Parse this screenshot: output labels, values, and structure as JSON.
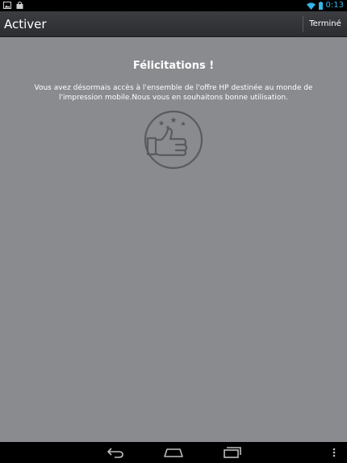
{
  "status_bar": {
    "time": "0:13",
    "icons": [
      "image-notification-icon",
      "store-notification-icon",
      "wifi-icon",
      "battery-icon"
    ],
    "accent_color": "#33b5e5"
  },
  "action_bar": {
    "title": "Activer",
    "done_label": "Terminé"
  },
  "content": {
    "heading": "Félicitations !",
    "message": "Vous avez désormais accès à l'ensemble de l'offre HP destinée au monde de l'impression mobile.Nous vous en souhaitons bonne utilisation.",
    "illustration_icon": "thumbs-up-stars-icon",
    "background_color": "#8a8b8f"
  },
  "nav_bar": {
    "icons": [
      "back-icon",
      "home-icon",
      "recent-apps-icon",
      "overflow-menu-icon"
    ]
  }
}
